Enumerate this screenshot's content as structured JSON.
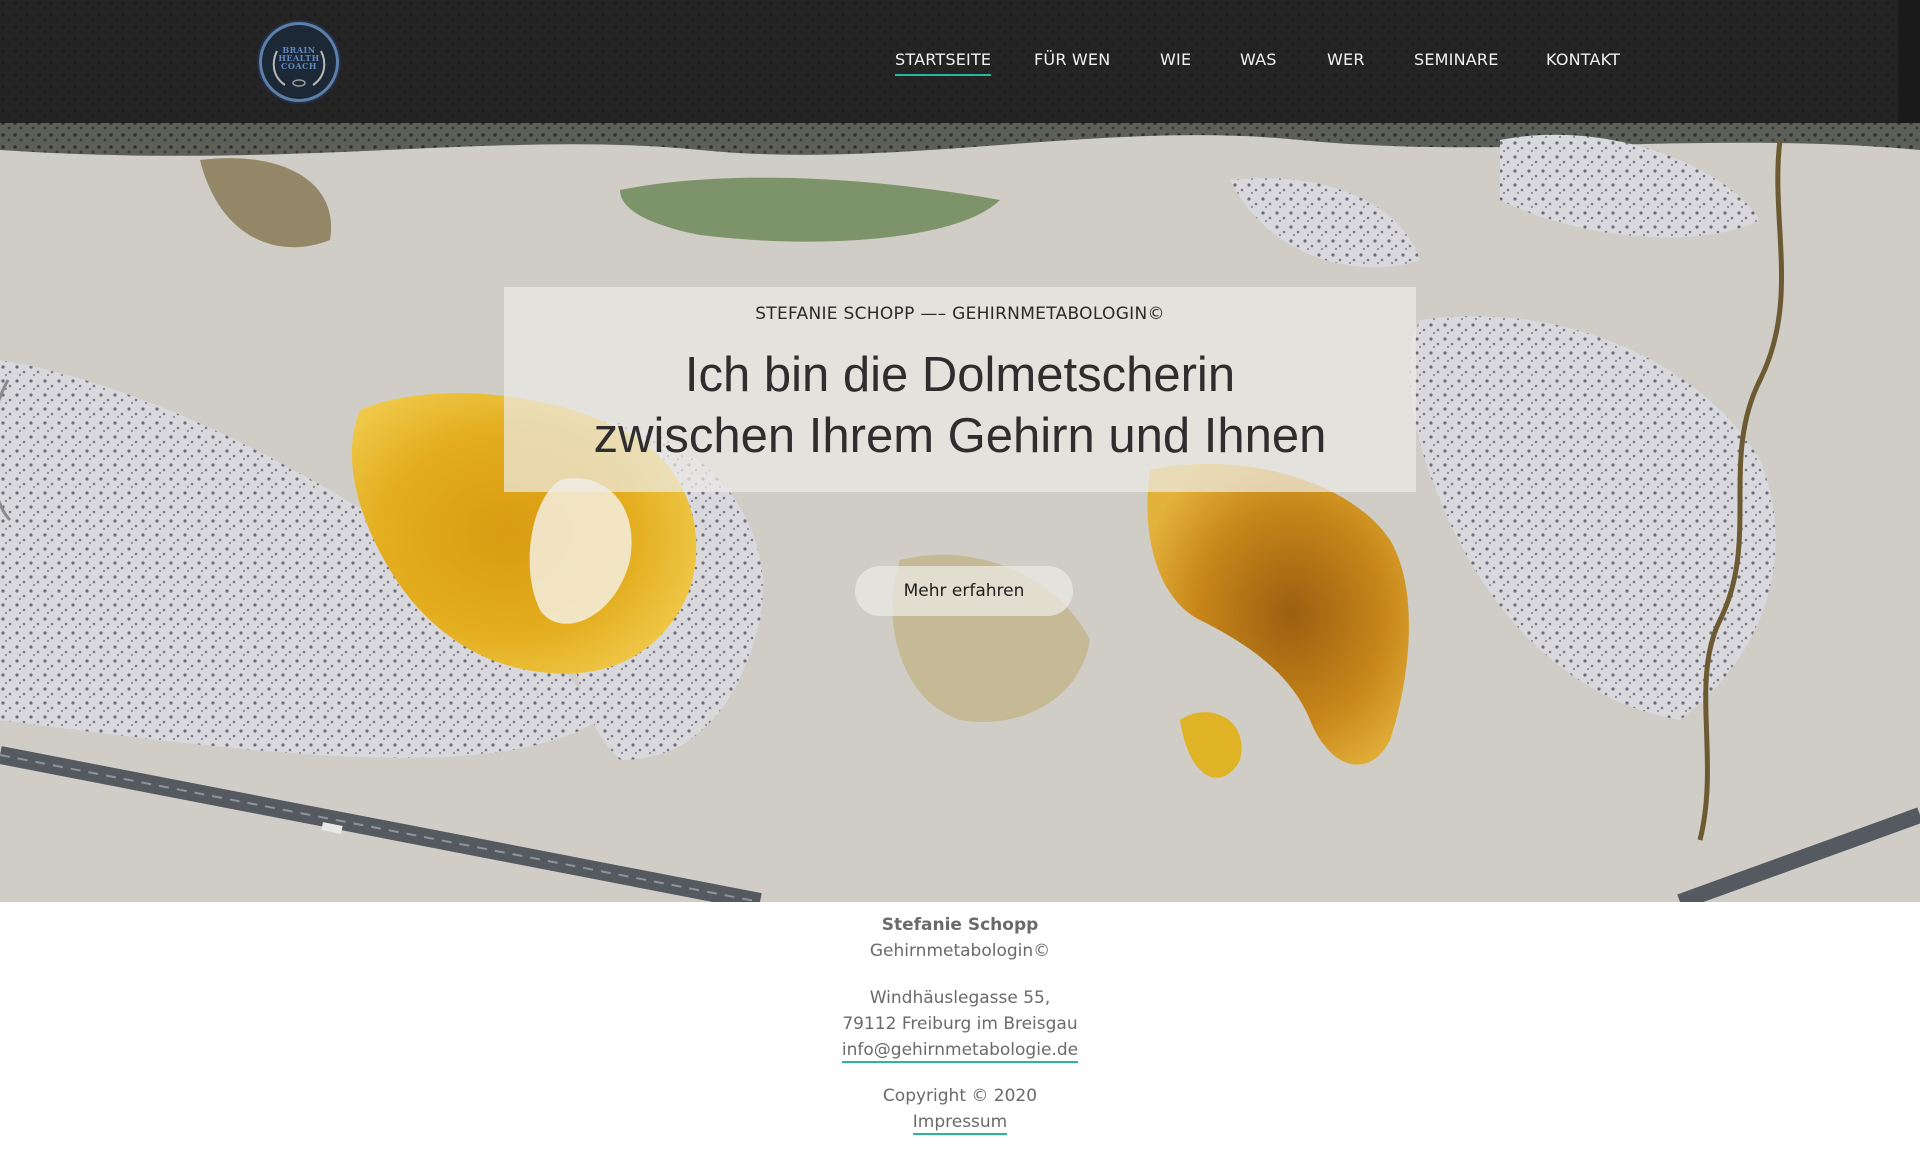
{
  "logo": {
    "lines": [
      "BRAIN",
      "HEALTH",
      "COACH"
    ],
    "icon": "brain-health-coach-logo-icon"
  },
  "nav": {
    "items": [
      {
        "label": "STARTSEITE",
        "active": true
      },
      {
        "label": "FÜR WEN",
        "active": false
      },
      {
        "label": "WIE",
        "active": false
      },
      {
        "label": "WAS",
        "active": false
      },
      {
        "label": "WER",
        "active": false
      },
      {
        "label": "SEMINARE",
        "active": false
      },
      {
        "label": "KONTAKT",
        "active": false
      }
    ]
  },
  "hero": {
    "eyebrow": "STEFANIE SCHOPP —– GEHIRNMETABOLOGIN©",
    "headline_line1": "Ich bin die Dolmetscherin",
    "headline_line2": "zwischen Ihrem Gehirn und Ihnen",
    "cta_label": "Mehr erfahren"
  },
  "footer": {
    "name": "Stefanie Schopp",
    "title": "Gehirnmetabologin©",
    "street": "Windhäuslegasse 55,",
    "city": "79112 Freiburg im Breisgau",
    "email": "info@gehirnmetabologie.de",
    "copyright": "Copyright © 2020",
    "impressum": "Impressum"
  },
  "colors": {
    "accent": "#2bb59b",
    "header_bg": "#1a1b1b",
    "text_dark": "#2e2e2e",
    "footer_text": "#6a6a6a"
  }
}
